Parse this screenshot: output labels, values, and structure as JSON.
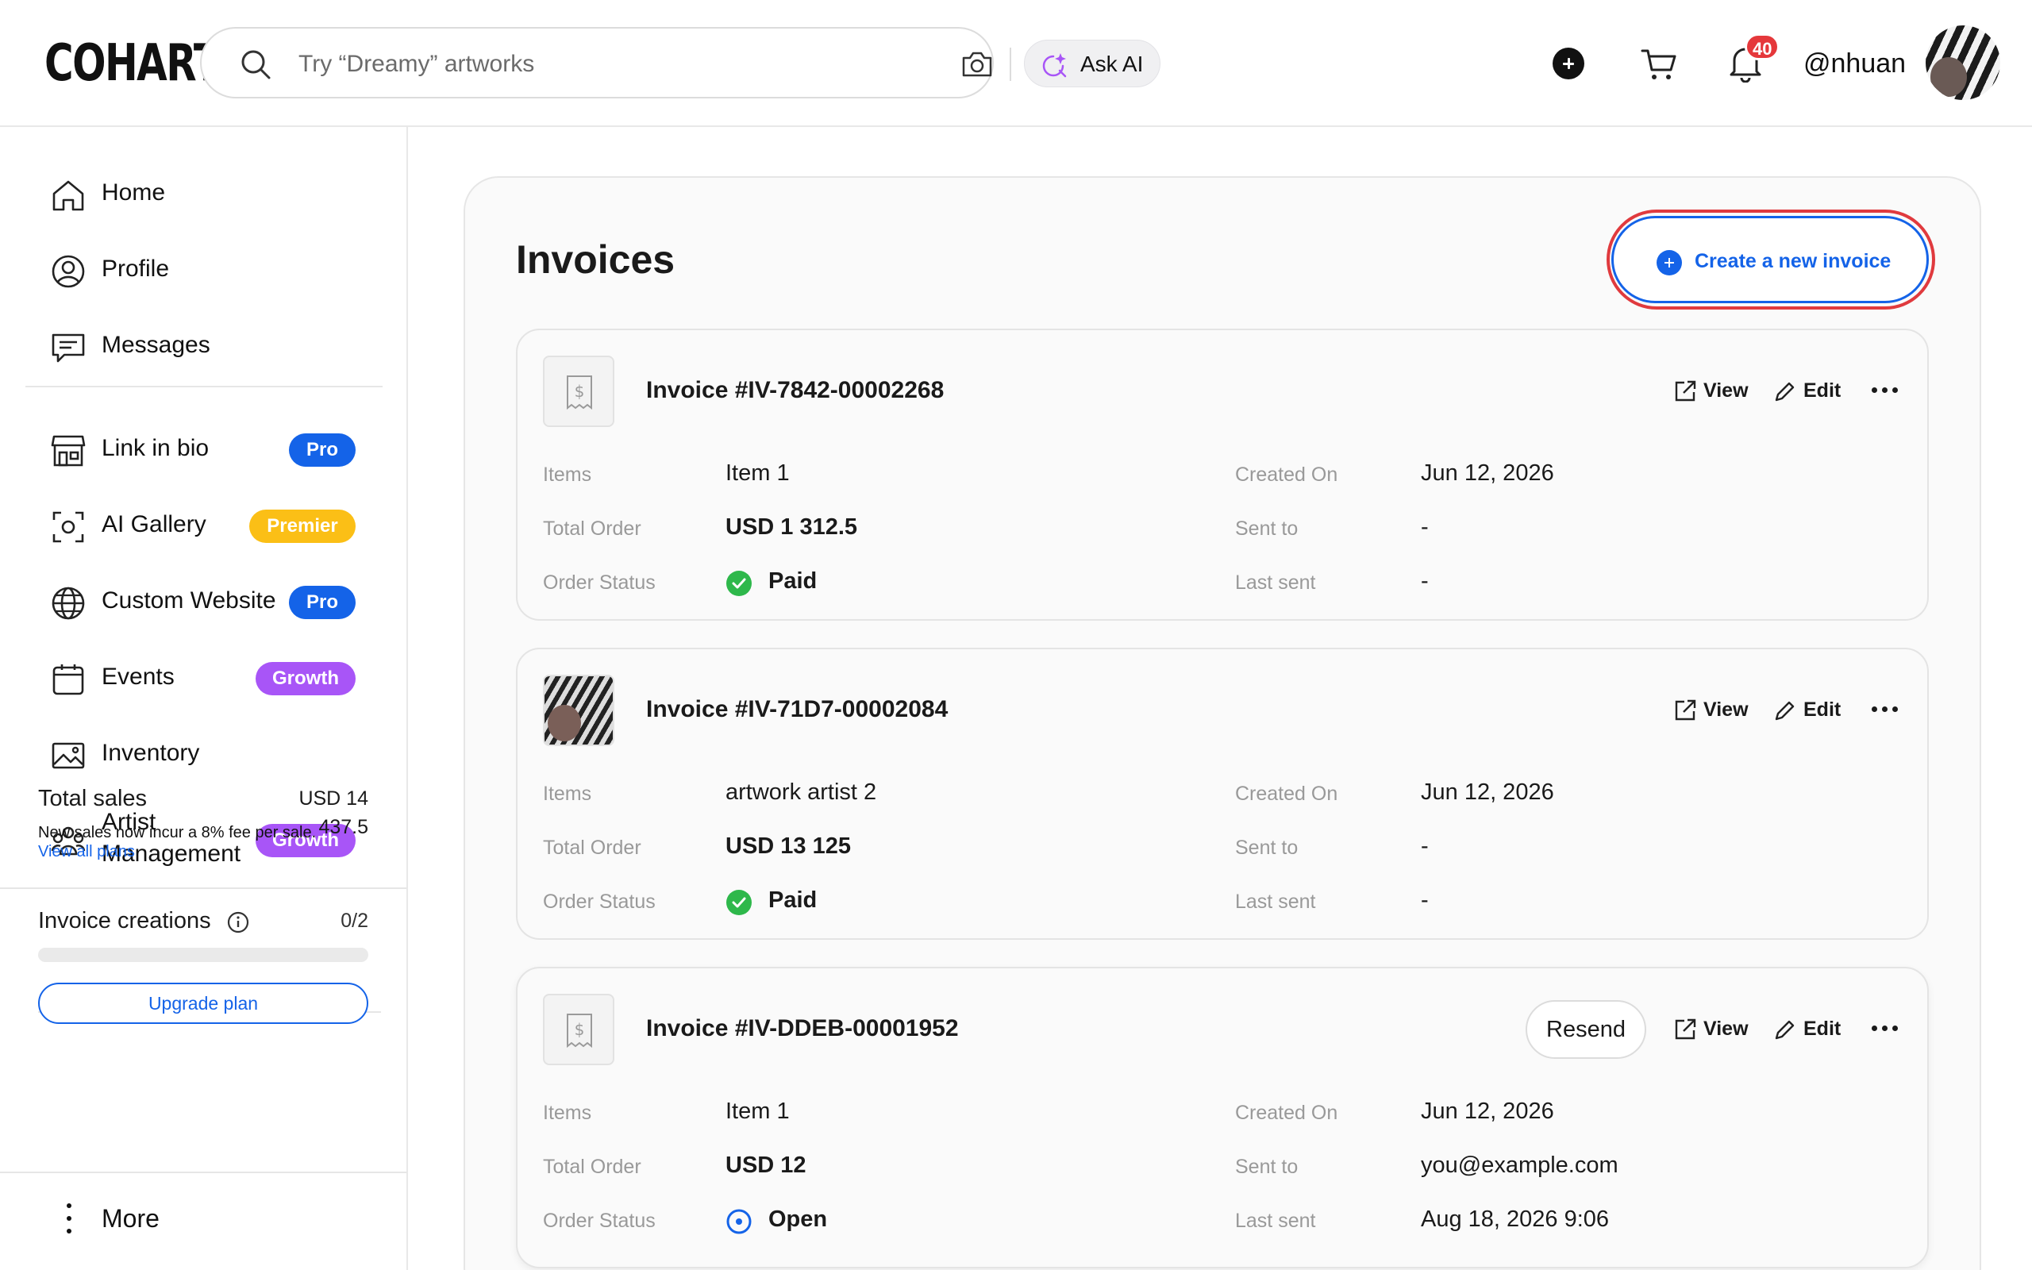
{
  "brand": {
    "logo": "COHART"
  },
  "search": {
    "placeholder": "Try “Dreamy” artworks",
    "ask_ai_label": "Ask AI"
  },
  "header": {
    "notification_count": "40",
    "username": "@nhuan"
  },
  "sidebar": {
    "nav": [
      {
        "label": "Home",
        "icon": "home-icon"
      },
      {
        "label": "Profile",
        "icon": "profile-icon"
      },
      {
        "label": "Messages",
        "icon": "messages-icon"
      }
    ],
    "plans": [
      {
        "label": "Link in bio",
        "icon": "storefront-icon",
        "badge": "Pro"
      },
      {
        "label": "AI Gallery",
        "icon": "scan-face-icon",
        "badge": "Premier"
      },
      {
        "label": "Custom Website",
        "icon": "globe-icon",
        "badge": "Pro"
      },
      {
        "label": "Events",
        "icon": "calendar-icon",
        "badge": "Growth"
      },
      {
        "label": "Inventory",
        "icon": "image-icon",
        "badge": ""
      },
      {
        "label": "Artist Management",
        "icon": "people-icon",
        "badge": "Growth"
      }
    ],
    "total_sales": {
      "title": "Total sales",
      "value": "USD 14 437.5",
      "note": "New sales now incur a 8% fee per sale.",
      "link": "View all plans"
    },
    "invoice_creations": {
      "title": "Invoice creations",
      "count": "0/2",
      "progress": 0,
      "upgrade_label": "Upgrade plan"
    },
    "more_label": "More"
  },
  "colors": {
    "accent": "#1463e8",
    "pro": "#1463e8",
    "premier": "#fbbf16",
    "growth": "#a855f7",
    "paid": "#2eb84b",
    "alert": "#e5383b"
  },
  "main": {
    "title": "Invoices",
    "create_label": "Create a new invoice",
    "field_labels": {
      "items": "Items",
      "total": "Total Order",
      "status": "Order Status",
      "created": "Created On",
      "sent_to": "Sent to",
      "last_sent": "Last sent"
    },
    "actions": {
      "view": "View",
      "edit": "Edit",
      "resend": "Resend"
    },
    "invoices": [
      {
        "number": "Invoice #IV-7842-00002268",
        "items": "Item 1",
        "total": "USD 1 312.5",
        "status": "Paid",
        "created": "Jun 12, 2026",
        "sent_to": "-",
        "last_sent": "-"
      },
      {
        "number": "Invoice #IV-71D7-00002084",
        "items": "artwork artist 2",
        "total": "USD 13 125",
        "status": "Paid",
        "created": "Jun 12, 2026",
        "sent_to": "-",
        "last_sent": "-"
      },
      {
        "number": "Invoice #IV-DDEB-00001952",
        "items": "Item 1",
        "total": "USD 12",
        "status": "Open",
        "created": "Jun 12, 2026",
        "sent_to": "you@example.com",
        "last_sent": "Aug 18, 2026 9:06"
      }
    ]
  }
}
